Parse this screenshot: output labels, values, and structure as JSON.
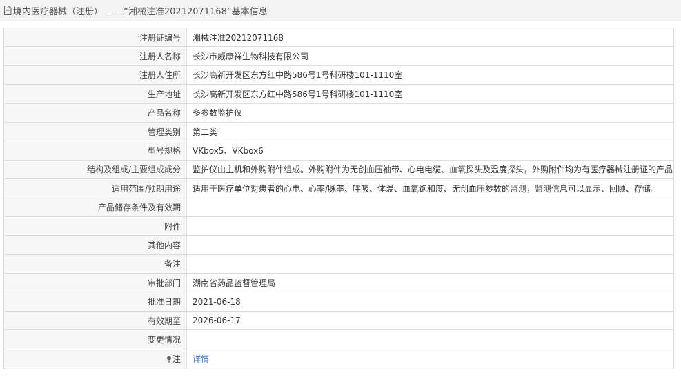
{
  "header": {
    "title": "境内医疗器械（注册） ——“湘械注准20212071168”基本信息"
  },
  "rows": [
    {
      "label": "注册证编号",
      "value": "湘械注准20212071168"
    },
    {
      "label": "注册人名称",
      "value": "长沙市威康祥生物科技有限公司"
    },
    {
      "label": "注册人住所",
      "value": "长沙高新开发区东方红中路586号1号科研楼101-1110室"
    },
    {
      "label": "生产地址",
      "value": "长沙高新开发区东方红中路586号1号科研楼101-1110室"
    },
    {
      "label": "产品名称",
      "value": "多参数监护仪"
    },
    {
      "label": "管理类别",
      "value": "第二类"
    },
    {
      "label": "型号规格",
      "value": "VKbox5、VKbox6"
    },
    {
      "label": "结构及组成/主要组成成分",
      "value": "监护仪由主机和外购附件组成。外购附件为无创血压袖带、心电电缆、血氧探头及温度探头，外购附件均为有医疗器械注册证的产品。"
    },
    {
      "label": "适用范围/预期用途",
      "value": "适用于医疗单位对患者的心电、心率/脉率、呼吸、体温、血氧饱和度、无创血压参数的监测，监测信息可以显示、回顾、存储。"
    },
    {
      "label": "产品储存条件及有效期",
      "value": ""
    },
    {
      "label": "附件",
      "value": ""
    },
    {
      "label": "其他内容",
      "value": ""
    },
    {
      "label": "备注",
      "value": ""
    },
    {
      "label": "审批部门",
      "value": "湖南省药品监督管理局"
    },
    {
      "label": "批准日期",
      "value": "2021-06-18"
    },
    {
      "label": "有效期至",
      "value": "2026-06-17"
    },
    {
      "label": "变更情况",
      "value": ""
    }
  ],
  "note": {
    "label": "注",
    "link_text": "详情",
    "icon": "pin-icon"
  },
  "colors": {
    "link": "#2c62b8",
    "label_bg": "#f7f7f7",
    "border": "#dcdcdc",
    "titlebar_bg": "#f3f3f3"
  }
}
